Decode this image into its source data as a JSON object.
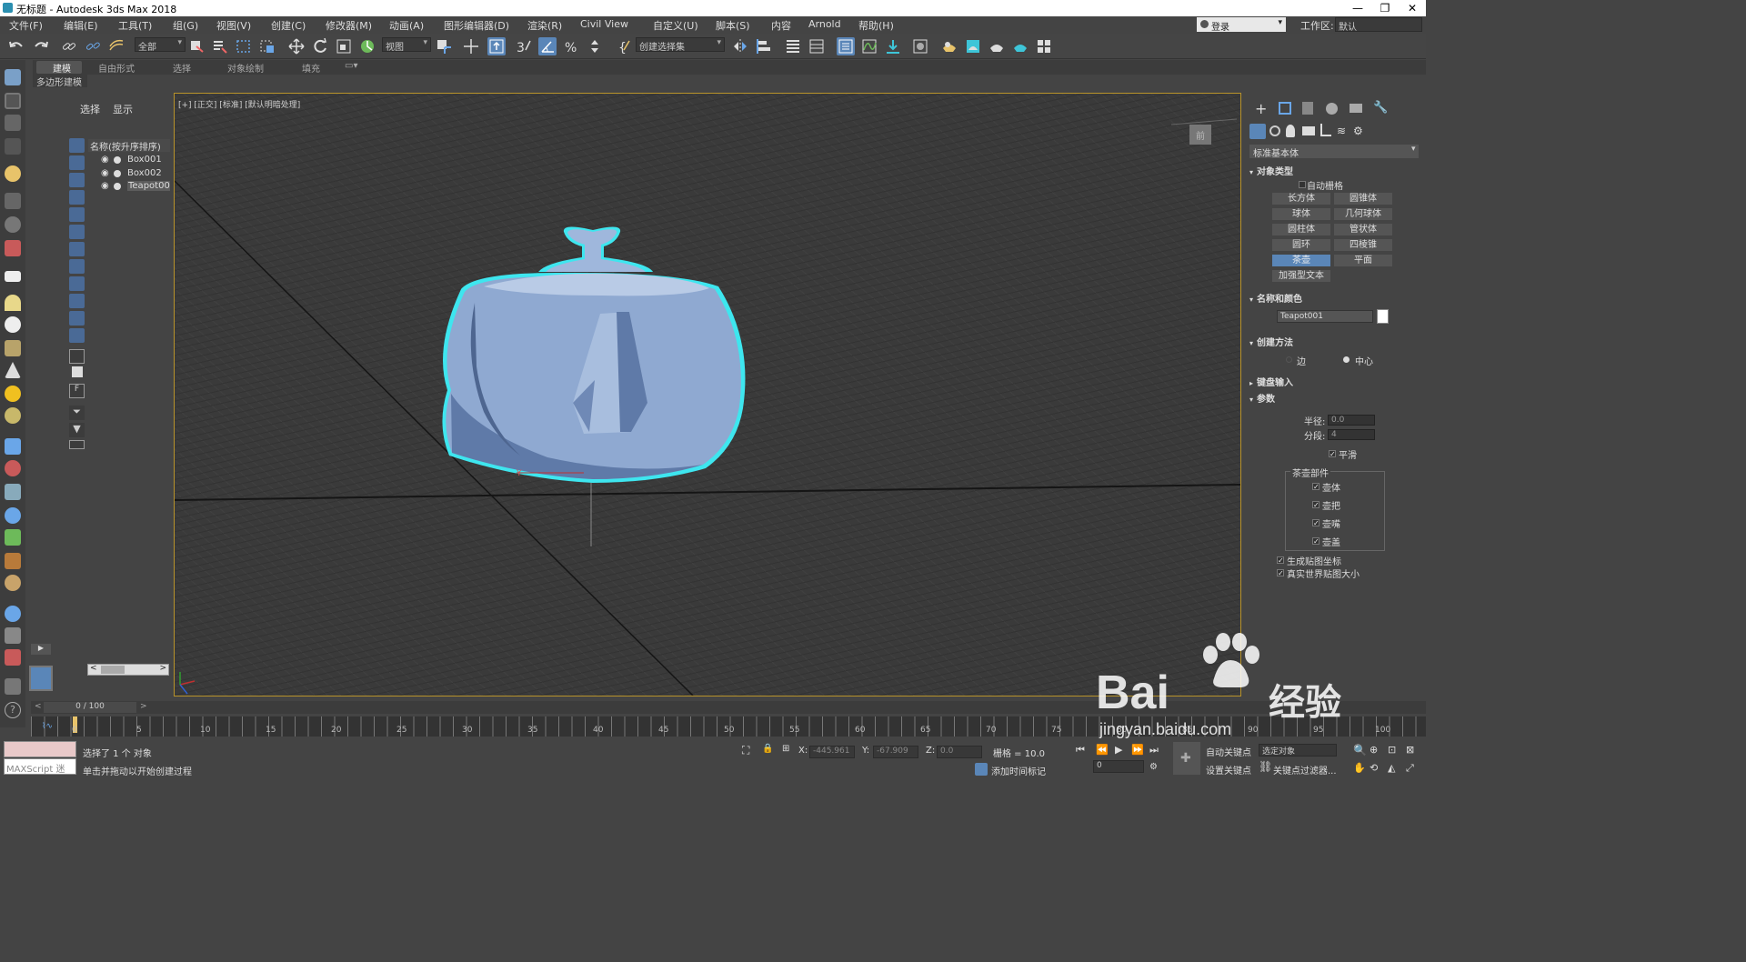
{
  "window": {
    "title": "无标题 - Autodesk 3ds Max 2018",
    "min": "—",
    "max": "❐",
    "close": "✕"
  },
  "menu": [
    "文件(F)",
    "编辑(E)",
    "工具(T)",
    "组(G)",
    "视图(V)",
    "创建(C)",
    "修改器(M)",
    "动画(A)",
    "图形编辑器(D)",
    "渲染(R)",
    "Civil View",
    "自定义(U)",
    "脚本(S)",
    "内容",
    "Arnold",
    "帮助(H)"
  ],
  "account": {
    "login": "登录",
    "workspace_label": "工作区:",
    "workspace_value": "默认"
  },
  "toolbar": {
    "filter": "全部",
    "ref_coord": "视图",
    "selection_set": "创建选择集"
  },
  "ribbon": {
    "tabs": [
      "建模",
      "自由形式",
      "选择",
      "对象绘制",
      "填充"
    ],
    "active": "建模",
    "sub": "多边形建模"
  },
  "explorer": {
    "tabs": [
      "选择",
      "显示"
    ],
    "header": "名称(按升序排序)",
    "rows": [
      "Box001",
      "Box002",
      "Teapot001"
    ],
    "scroll_left": "<",
    "scroll_right": ">"
  },
  "viewport": {
    "label": "[+] [正交] [标准] [默认明暗处理]",
    "gizmo_y": "Y"
  },
  "command_panel": {
    "dropdown": "标准基本体",
    "object_type": {
      "title": "对象类型",
      "autogrid": "自动栅格",
      "buttons": [
        "长方体",
        "圆锥体",
        "球体",
        "几何球体",
        "圆柱体",
        "管状体",
        "圆环",
        "四棱锥",
        "茶壶",
        "平面",
        "加强型文本"
      ],
      "selected": "茶壶"
    },
    "name_color": {
      "title": "名称和颜色",
      "name": "Teapot001",
      "swatch": "#ffffff"
    },
    "creation_method": {
      "title": "创建方法",
      "edge": "边",
      "center": "中心"
    },
    "keyboard_entry": {
      "title": "键盘输入"
    },
    "params": {
      "title": "参数",
      "radius_label": "半径:",
      "radius": "0.0",
      "segments_label": "分段:",
      "segments": "4",
      "smooth": "平滑",
      "parts_title": "茶壶部件",
      "parts": [
        "壶体",
        "壶把",
        "壶嘴",
        "壶盖"
      ],
      "gen_map": "生成贴图坐标",
      "real_world": "真实世界贴图大小"
    }
  },
  "timeline": {
    "frame": "0 / 100",
    "ticks": [
      "0",
      "5",
      "10",
      "15",
      "20",
      "25",
      "30",
      "35",
      "40",
      "45",
      "50",
      "55",
      "60",
      "65",
      "70",
      "75",
      "80",
      "85",
      "90",
      "95",
      "100"
    ]
  },
  "status": {
    "maxscript": "MAXScript 迷",
    "selected": "选择了 1 个 对象",
    "prompt": "单击并拖动以开始创建过程",
    "x_label": "X:",
    "x": "-445.961",
    "y_label": "Y:",
    "y": "-67.909",
    "z_label": "Z:",
    "z": "0.0",
    "grid": "栅格 = 10.0",
    "add_time_tag": "添加时间标记",
    "auto_key": "自动关键点",
    "set_key": "设置关键点",
    "selected_obj": "选定对象",
    "key_filters": "关键点过滤器...",
    "frame_input": "0"
  },
  "watermark": {
    "brand": "Bai",
    "brand2": "经验",
    "url": "jingyan.baidu.com"
  },
  "colors": {
    "accent": "#5a86b8",
    "viewport_border": "#b8932a",
    "teapot": "#8fa9d1",
    "outline": "#3ee6ef"
  }
}
